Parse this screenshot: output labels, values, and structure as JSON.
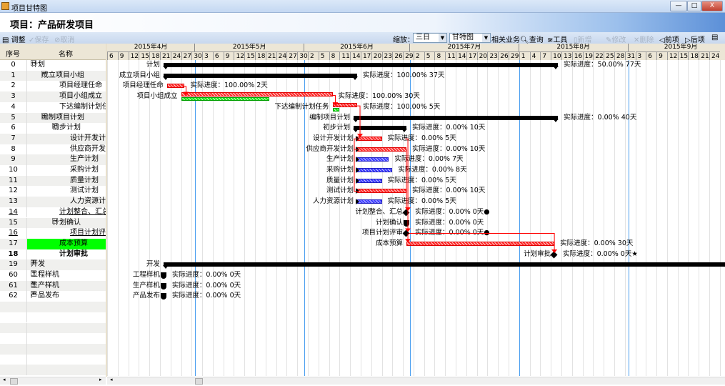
{
  "window": {
    "title": "项目甘特图",
    "minimize": "—",
    "maximize": "□",
    "close": "X"
  },
  "project_title": "项目：产品研发项目",
  "toolbar": {
    "adjust": "调整",
    "save": "保存",
    "cancel": "取消",
    "zoom_label": "缩放：",
    "zoom_value": "三日",
    "view_value": "甘特图",
    "related": "相关业务",
    "query": "查询",
    "tools": "工具",
    "add": "新增",
    "edit": "修改",
    "delete": "删除",
    "prev": "前项",
    "next": "后项"
  },
  "columns": {
    "id": "序号",
    "name": "名称"
  },
  "timeline": {
    "months": [
      {
        "label": "2015年4月",
        "start": "2015-04-06",
        "end": "2015-05-01"
      },
      {
        "label": "2015年5月",
        "start": "2015-05-01",
        "end": "2015-06-01"
      },
      {
        "label": "2015年6月",
        "start": "2015-06-01",
        "end": "2015-07-01"
      },
      {
        "label": "2015年7月",
        "start": "2015-07-01",
        "end": "2015-08-01"
      },
      {
        "label": "2015年8月",
        "start": "2015-08-01",
        "end": "2015-09-01"
      },
      {
        "label": "2015年9月",
        "start": "2015-09-01",
        "end": "2015-10-01"
      }
    ],
    "days": [
      "6",
      "9",
      "12",
      "15",
      "18",
      "21",
      "24",
      "27",
      "30",
      "3",
      "6",
      "9",
      "12",
      "15",
      "18",
      "21",
      "24",
      "27",
      "30",
      "2",
      "5",
      "8",
      "11",
      "14",
      "17",
      "20",
      "23",
      "26",
      "29",
      "2",
      "5",
      "8",
      "11",
      "14",
      "17",
      "20",
      "23",
      "26",
      "29",
      "1",
      "4",
      "7",
      "10",
      "13",
      "16",
      "19",
      "22",
      "25",
      "28",
      "31",
      "3",
      "6",
      "9",
      "12",
      "15",
      "18",
      "21",
      "24"
    ],
    "origin": "2015-04-06",
    "scale": "三日"
  },
  "colors": {
    "critical": "#ff2a2a",
    "normal": "#3a3aff",
    "actual": "#10e010",
    "summary": "#000000",
    "month_line": "#4a9ef0",
    "highlight": "#00ff00"
  },
  "tasks": [
    {
      "id": "0",
      "name": "计划",
      "level": 0,
      "expander": "⊟",
      "bar": {
        "type": "summary",
        "start": "2015-04-22",
        "end": "2015-08-12"
      },
      "note": "实际进度：50.00% 77天"
    },
    {
      "id": "1",
      "name": "成立项目小组",
      "level": 1,
      "expander": "⊟",
      "bar": {
        "type": "summary",
        "start": "2015-04-22",
        "end": "2015-06-16"
      },
      "note": "实际进度：100.00% 37天"
    },
    {
      "id": "2",
      "name": "项目经理任命",
      "level": 2,
      "bar": {
        "type": "red",
        "start": "2015-04-23",
        "end": "2015-04-28"
      },
      "note": "实际进度：100.00% 2天"
    },
    {
      "id": "3",
      "name": "项目小组成立",
      "level": 2,
      "bar": {
        "type": "red",
        "start": "2015-04-27",
        "end": "2015-06-09",
        "actual_end": "2015-05-22"
      },
      "note": "实际进度：100.00% 30天"
    },
    {
      "id": "4",
      "name": "下达编制计划任务",
      "level": 2,
      "bar": {
        "type": "red",
        "start": "2015-06-09",
        "end": "2015-06-16",
        "actual_end": "2015-06-11"
      },
      "note": "实际进度：100.00% 5天"
    },
    {
      "id": "5",
      "name": "编制项目计划",
      "level": 1,
      "expander": "⊟",
      "bar": {
        "type": "summary",
        "start": "2015-06-15",
        "end": "2015-08-12"
      },
      "note": "实际进度：0.00% 40天"
    },
    {
      "id": "6",
      "name": "初步计划",
      "level": 2,
      "expander": "⊟",
      "bar": {
        "type": "summary",
        "start": "2015-06-15",
        "end": "2015-06-30"
      },
      "note": "实际进度：0.00% 10天"
    },
    {
      "id": "7",
      "name": "设计开发计划",
      "level": 3,
      "bar": {
        "type": "red",
        "start": "2015-06-16",
        "end": "2015-06-23"
      },
      "note": "实际进度：0.00% 5天"
    },
    {
      "id": "8",
      "name": "供应商开发计划",
      "level": 3,
      "bar": {
        "type": "red",
        "start": "2015-06-16",
        "end": "2015-06-30"
      },
      "note": "实际进度：0.00% 10天"
    },
    {
      "id": "9",
      "name": "生产计划",
      "level": 3,
      "bar": {
        "type": "blue",
        "start": "2015-06-16",
        "end": "2015-06-25"
      },
      "note": "实际进度：0.00% 7天"
    },
    {
      "id": "10",
      "name": "采购计划",
      "level": 3,
      "bar": {
        "type": "blue",
        "start": "2015-06-16",
        "end": "2015-06-26"
      },
      "note": "实际进度：0.00% 8天"
    },
    {
      "id": "11",
      "name": "质量计划",
      "level": 3,
      "bar": {
        "type": "blue",
        "start": "2015-06-16",
        "end": "2015-06-23"
      },
      "note": "实际进度：0.00% 5天"
    },
    {
      "id": "12",
      "name": "测试计划",
      "level": 3,
      "bar": {
        "type": "red",
        "start": "2015-06-16",
        "end": "2015-06-30"
      },
      "note": "实际进度：0.00% 10天"
    },
    {
      "id": "13",
      "name": "人力资源计划",
      "level": 3,
      "bar": {
        "type": "blue",
        "start": "2015-06-16",
        "end": "2015-06-23"
      },
      "note": "实际进度：0.00% 5天"
    },
    {
      "id": "14",
      "name": "计划整合、汇总",
      "level": 2,
      "underline": true,
      "bar": {
        "type": "diamond",
        "start": "2015-06-30"
      },
      "note": "实际进度：0.00% 0天",
      "marker": "●"
    },
    {
      "id": "15",
      "name": "计划确认",
      "level": 2,
      "expander": "⊟",
      "bar": {
        "type": "shield",
        "start": "2015-06-30"
      },
      "note": "实际进度：0.00% 0天"
    },
    {
      "id": "16",
      "name": "项目计划评审",
      "level": 3,
      "underline": true,
      "bar": {
        "type": "diamond",
        "start": "2015-06-30"
      },
      "note": "实际进度：0.00% 0天",
      "marker": "●"
    },
    {
      "id": "17",
      "name": "成本预算",
      "level": 2,
      "highlight": true,
      "bar": {
        "type": "red",
        "start": "2015-06-30",
        "end": "2015-08-11"
      },
      "note": "实际进度：0.00% 30天"
    },
    {
      "id": "18",
      "name": "计划审批",
      "level": 2,
      "bold": true,
      "bar": {
        "type": "diamond",
        "start": "2015-08-11"
      },
      "note": "实际进度：0.00% 0天",
      "marker": "★"
    },
    {
      "id": "19",
      "name": "开发",
      "level": 0,
      "expander": "⊞",
      "bar": {
        "type": "summary",
        "start": "2015-04-22",
        "end": "2015-10-01"
      },
      "note": ""
    },
    {
      "id": "60",
      "name": "工程样机",
      "level": 0,
      "expander": "⊞",
      "bar": {
        "type": "shield",
        "start": "2015-04-22"
      },
      "note": "实际进度：0.00% 0天"
    },
    {
      "id": "61",
      "name": "生产样机",
      "level": 0,
      "expander": "⊞",
      "bar": {
        "type": "shield",
        "start": "2015-04-22"
      },
      "note": "实际进度：0.00% 0天"
    },
    {
      "id": "62",
      "name": "产品发布",
      "level": 0,
      "expander": "⊞",
      "bar": {
        "type": "shield",
        "start": "2015-04-22"
      },
      "note": "实际进度：0.00% 0天"
    }
  ]
}
